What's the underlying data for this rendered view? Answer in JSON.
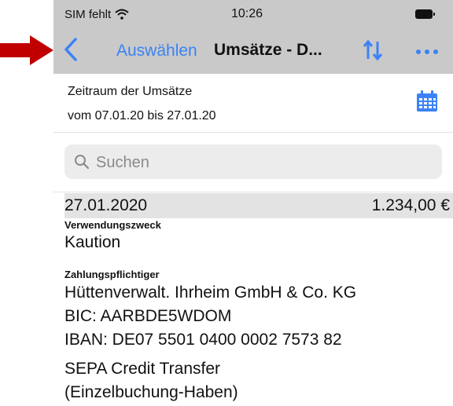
{
  "status_bar": {
    "carrier": "SIM fehlt",
    "time": "10:26"
  },
  "nav": {
    "select_label": "Auswählen",
    "title": "Umsätze - D...",
    "accent_color": "#3b82f6"
  },
  "annotation": {
    "arrow_color": "#c00000"
  },
  "period": {
    "title": "Zeitraum der Umsätze",
    "range": "vom 07.01.20 bis 27.01.20"
  },
  "search": {
    "placeholder": "Suchen"
  },
  "transaction": {
    "date": "27.01.2020",
    "amount": "1.234,00 €",
    "purpose_label": "Verwendungszweck",
    "purpose": "Kaution",
    "payer_label": "Zahlungspflichtiger",
    "payer_name": "Hüttenverwalt. Ihrheim GmbH & Co. KG",
    "bic": "BIC: AARBDE5WDOM",
    "iban": "IBAN: DE07 5501 0400 0002 7573 82",
    "type_line1": "SEPA Credit Transfer",
    "type_line2": "(Einzelbuchung-Haben)"
  }
}
